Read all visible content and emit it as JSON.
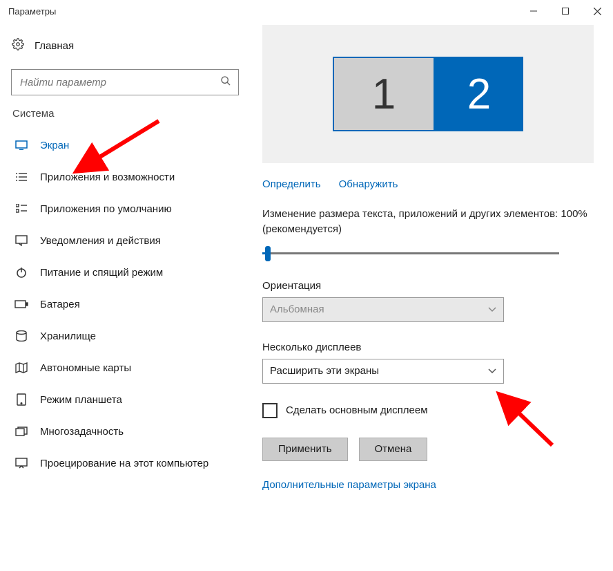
{
  "window": {
    "title": "Параметры"
  },
  "sidebar": {
    "home": "Главная",
    "search_placeholder": "Найти параметр",
    "section": "Система",
    "items": [
      {
        "label": "Экран",
        "active": true
      },
      {
        "label": "Приложения и возможности"
      },
      {
        "label": "Приложения по умолчанию"
      },
      {
        "label": "Уведомления и действия"
      },
      {
        "label": "Питание и спящий режим"
      },
      {
        "label": "Батарея"
      },
      {
        "label": "Хранилище"
      },
      {
        "label": "Автономные карты"
      },
      {
        "label": "Режим планшета"
      },
      {
        "label": "Многозадачность"
      },
      {
        "label": "Проецирование на этот компьютер"
      }
    ]
  },
  "main": {
    "monitor1": "1",
    "monitor2": "2",
    "identify": "Определить",
    "detect": "Обнаружить",
    "scale_text": "Изменение размера текста, приложений и других элементов: 100% (рекомендуется)",
    "orientation_label": "Ориентация",
    "orientation_value": "Альбомная",
    "multi_label": "Несколько дисплеев",
    "multi_value": "Расширить эти экраны",
    "make_main": "Сделать основным дисплеем",
    "apply": "Применить",
    "cancel": "Отмена",
    "advanced": "Дополнительные параметры экрана"
  }
}
